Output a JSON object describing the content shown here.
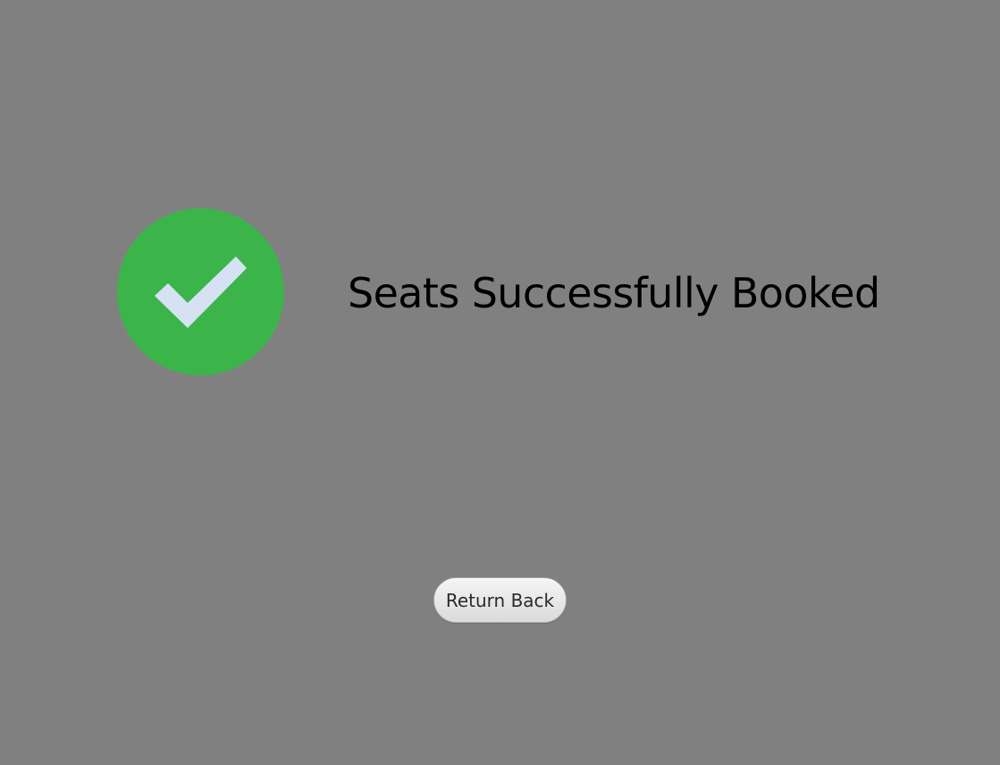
{
  "success": {
    "icon": "check-circle-icon",
    "icon_color": "#3bb54a",
    "check_color": "#d6e2f4",
    "message": "Seats Successfully Booked"
  },
  "actions": {
    "return_label": "Return Back"
  },
  "colors": {
    "background": "#808080",
    "text": "#000000"
  }
}
